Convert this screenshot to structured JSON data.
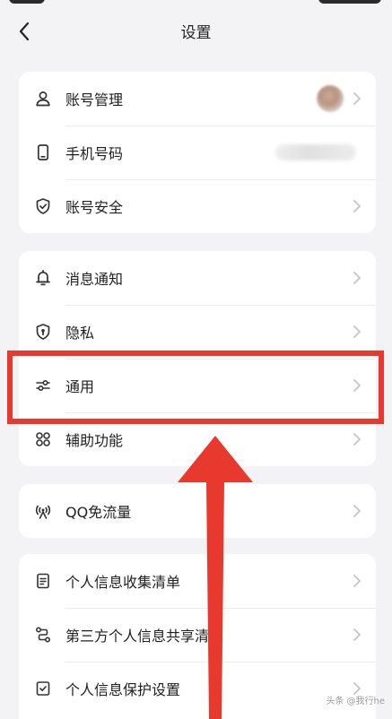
{
  "header": {
    "title": "设置"
  },
  "groups": [
    {
      "items": [
        {
          "label": "账号管理",
          "icon": "person-icon"
        },
        {
          "label": "手机号码",
          "icon": "phone-icon"
        },
        {
          "label": "账号安全",
          "icon": "shield-icon"
        }
      ]
    },
    {
      "items": [
        {
          "label": "消息通知",
          "icon": "bell-icon"
        },
        {
          "label": "隐私",
          "icon": "privacy-shield-icon"
        },
        {
          "label": "通用",
          "icon": "sliders-icon"
        },
        {
          "label": "辅助功能",
          "icon": "grid-icon"
        }
      ]
    },
    {
      "items": [
        {
          "label": "QQ免流量",
          "icon": "signal-icon"
        }
      ]
    },
    {
      "items": [
        {
          "label": "个人信息收集清单",
          "icon": "document-icon"
        },
        {
          "label": "第三方个人信息共享清单",
          "icon": "share-icon"
        },
        {
          "label": "个人信息保护设置",
          "icon": "checklist-icon"
        }
      ]
    }
  ],
  "annotation": {
    "highlight_color": "#e8392f",
    "highlighted_item": "通用"
  },
  "watermark": {
    "text": "头条 @我行he"
  }
}
